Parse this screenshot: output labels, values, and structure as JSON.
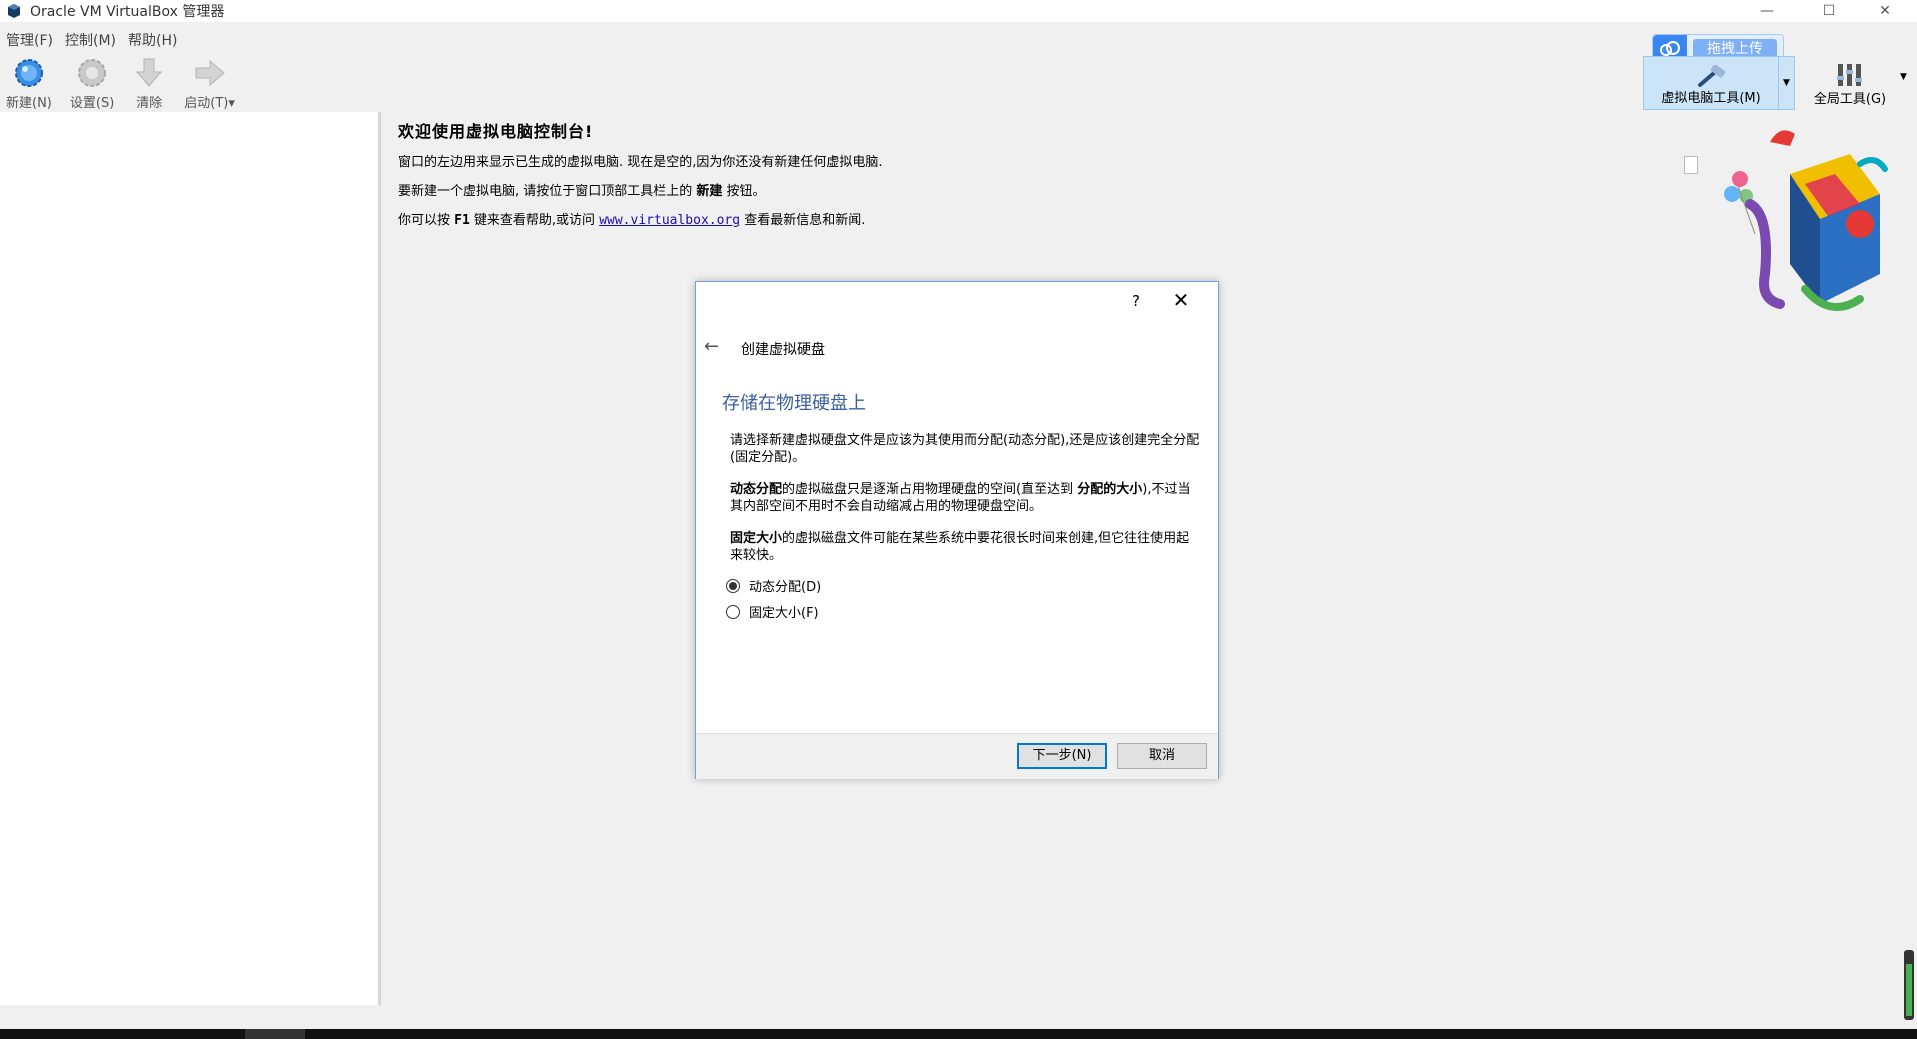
{
  "window": {
    "title": "Oracle VM VirtualBox 管理器",
    "minimize_glyph": "—",
    "maximize_glyph": "☐",
    "close_glyph": "✕"
  },
  "menubar": {
    "items": [
      "管理(F)",
      "控制(M)",
      "帮助(H)"
    ]
  },
  "toolbar": {
    "new_label": "新建(N)",
    "settings_label": "设置(S)",
    "discard_label": "清除",
    "start_label": "启动(T)",
    "start_arrow": "▾",
    "machine_tools_label": "虚拟电脑工具(M)",
    "global_tools_label": "全局工具(G)",
    "dropdown_arrow": "▼"
  },
  "upload_widget": {
    "label": "拖拽上传"
  },
  "welcome": {
    "title": "欢迎使用虚拟电脑控制台!",
    "line1": "窗口的左边用来显示已生成的虚拟电脑. 现在是空的,因为你还没有新建任何虚拟电脑.",
    "line2_pre": "要新建一个虚拟电脑, 请按位于窗口顶部工具栏上的 ",
    "line2_bold": "新建",
    "line2_post": " 按钮。",
    "line3_pre": "你可以按 ",
    "line3_key": "F1",
    "line3_mid": " 键来查看帮助,或访问 ",
    "line3_link": "www.virtualbox.org",
    "line3_post": " 查看最新信息和新闻."
  },
  "dialog": {
    "help_glyph": "?",
    "close_glyph": "✕",
    "back_glyph": "←",
    "wizard_title": "创建虚拟硬盘",
    "heading": "存储在物理硬盘上",
    "para1": "请选择新建虚拟硬盘文件是应该为其使用而分配(动态分配),还是应该创建完全分配(固定分配)。",
    "para2_bold1": "动态分配",
    "para2_text1": "的虚拟磁盘只是逐渐占用物理硬盘的空间(直至达到 ",
    "para2_bold2": "分配的大小",
    "para2_text2": "),不过当其内部空间不用时不会自动缩减占用的物理硬盘空间。",
    "para3_bold": "固定大小",
    "para3_text": "的虚拟磁盘文件可能在某些系统中要花很长时间来创建,但它往往使用起来较快。",
    "options": [
      {
        "label": "动态分配(D)",
        "checked": true
      },
      {
        "label": "固定大小(F)",
        "checked": false
      }
    ],
    "next_label": "下一步(N)",
    "cancel_label": "取消"
  },
  "colors": {
    "accent": "#0078d7",
    "heading": "#3d5f9e",
    "link": "#1a0dab",
    "tool_selected_bg": "#cce4f7"
  }
}
